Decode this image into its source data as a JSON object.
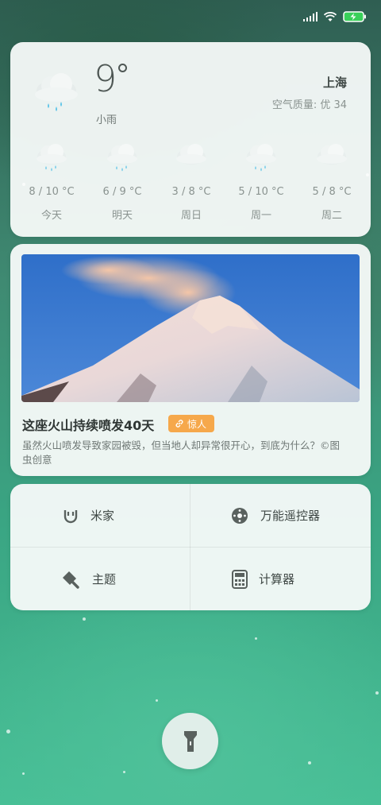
{
  "weather": {
    "temp": "9",
    "condition": "小雨",
    "city": "上海",
    "air_quality": "空气质量: 优 34",
    "forecast": [
      {
        "temp": "8 / 10 °C",
        "day": "今天",
        "icon": "rain-cloud-icon"
      },
      {
        "temp": "6 / 9 °C",
        "day": "明天",
        "icon": "rain-cloud-icon"
      },
      {
        "temp": "3 / 8 °C",
        "day": "周日",
        "icon": "cloud-icon"
      },
      {
        "temp": "5 / 10 °C",
        "day": "周一",
        "icon": "rain-cloud-icon"
      },
      {
        "temp": "5 / 8 °C",
        "day": "周二",
        "icon": "cloud-icon"
      }
    ]
  },
  "news": {
    "title": "这座火山持续喷发40天",
    "tag": "惊人",
    "description": "虽然火山喷发导致家园被毁，但当地人却异常很开心，到底为什么？©图虫创意"
  },
  "shortcuts": {
    "mijia": "米家",
    "remote": "万能遥控器",
    "theme": "主题",
    "calculator": "计算器"
  },
  "colors": {
    "tag": "#f6a84b",
    "card": "#f7faf9",
    "battery": "#39d05a"
  }
}
